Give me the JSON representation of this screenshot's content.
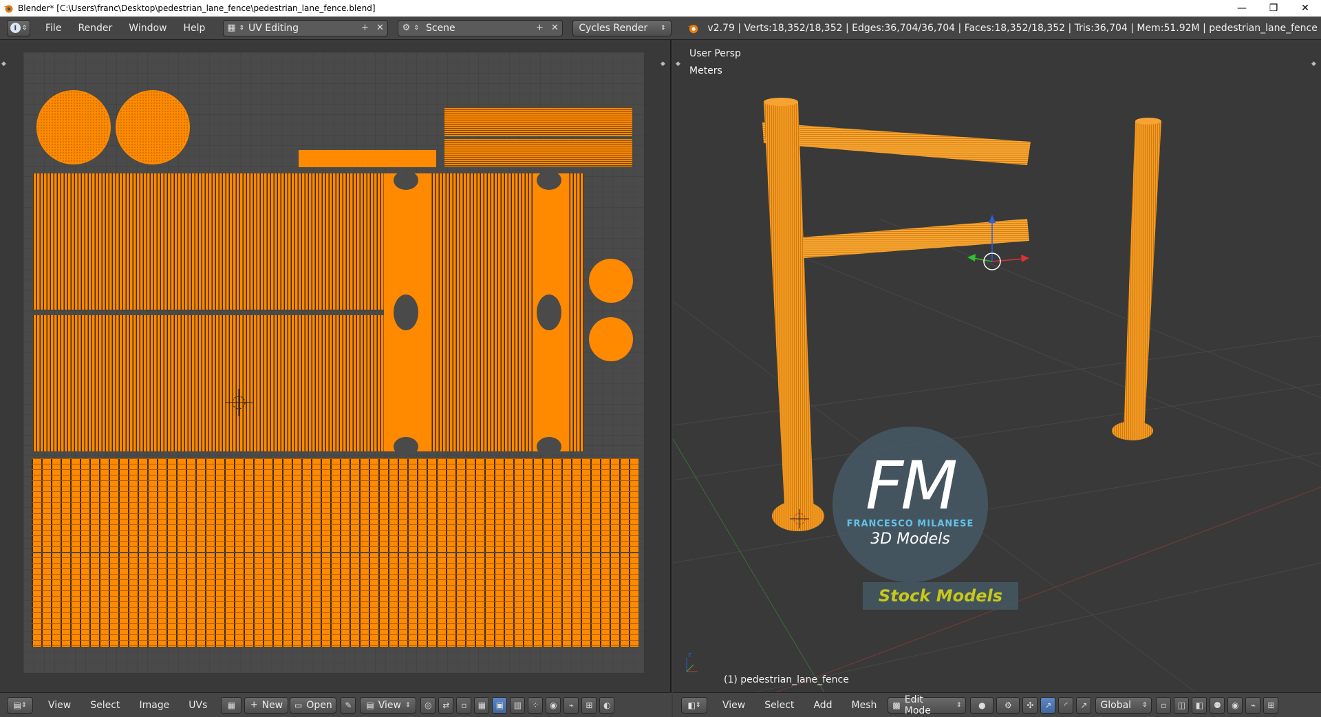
{
  "window": {
    "title": "Blender* [C:\\Users\\franc\\Desktop\\pedestrian_lane_fence\\pedestrian_lane_fence.blend]",
    "minimize": "—",
    "maximize": "❐",
    "close": "✕"
  },
  "info_header": {
    "menus": [
      "File",
      "Render",
      "Window",
      "Help"
    ],
    "screen_layout": "UV Editing",
    "scene": "Scene",
    "render_engine": "Cycles Render",
    "stats": "v2.79 | Verts:18,352/18,352 | Edges:36,704/36,704 | Faces:18,352/18,352 | Tris:36,704 | Mem:51.92M | pedestrian_lane_fence"
  },
  "uv_editor": {
    "footer": {
      "menus": [
        "View",
        "Select",
        "Image",
        "UVs"
      ],
      "new_label": "New",
      "open_label": "Open",
      "view_label": "View"
    }
  },
  "viewport": {
    "view_name": "User Persp",
    "units": "Meters",
    "object_label": "(1) pedestrian_lane_fence",
    "watermark": {
      "logo": "FM",
      "line1": "FRANCESCO MILANESE",
      "line2": "3D Models",
      "line3": "Stock Models"
    },
    "footer": {
      "menus": [
        "View",
        "Select",
        "Add",
        "Mesh"
      ],
      "mode": "Edit Mode",
      "orientation": "Global"
    }
  },
  "colors": {
    "accent_orange": "#ff8a00",
    "uv_grid_bg": "#4a4a4a",
    "panel_bg": "#393939",
    "header_bg": "#454545"
  }
}
